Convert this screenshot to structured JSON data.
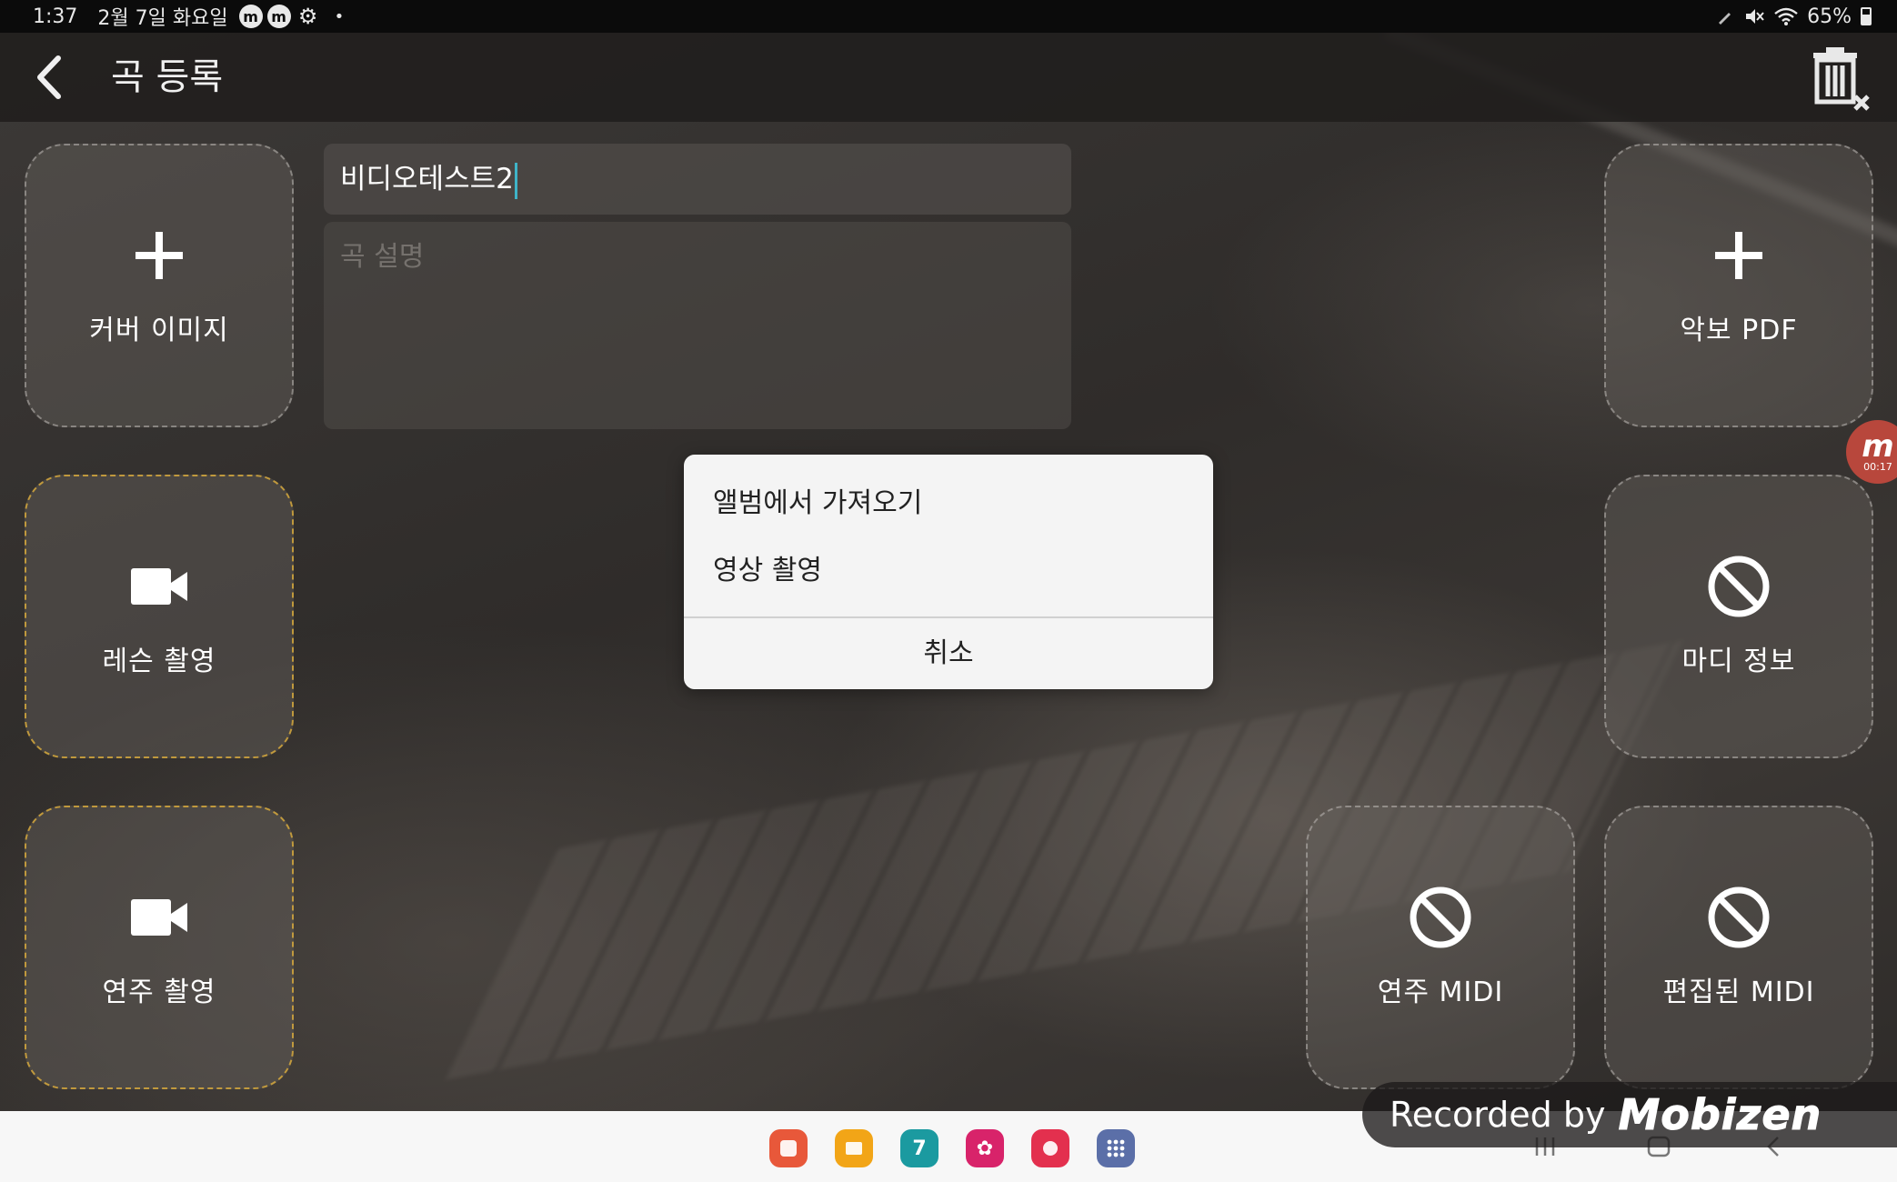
{
  "status_bar": {
    "time": "1:37",
    "date": "2월 7일 화요일",
    "battery": "65%",
    "notification_icons": [
      "mobizen-icon",
      "mobizen-icon",
      "gear-icon",
      "dot-icon"
    ],
    "system_icons": [
      "pen-icon",
      "mute-icon",
      "wifi-icon",
      "battery-icon"
    ]
  },
  "header": {
    "title": "곡 등록",
    "back_icon": "chevron-left-icon",
    "delete_icon": "trash-x-icon"
  },
  "form": {
    "title_value": "비디오테스트2",
    "description_placeholder": "곡 설명"
  },
  "tiles": {
    "cover_image": {
      "label": "커버 이미지",
      "icon": "plus-icon"
    },
    "sheet_pdf": {
      "label": "악보 PDF",
      "icon": "plus-icon"
    },
    "lesson_recording": {
      "label": "레슨 촬영",
      "icon": "video-camera-icon"
    },
    "madi_info": {
      "label": "마디 정보",
      "icon": "block-icon"
    },
    "performance_recording": {
      "label": "연주 촬영",
      "icon": "video-camera-icon"
    },
    "performance_midi": {
      "label": "연주 MIDI",
      "icon": "block-icon"
    },
    "edited_midi": {
      "label": "편집된 MIDI",
      "icon": "block-icon"
    }
  },
  "dialog": {
    "option_album": "앨범에서 가져오기",
    "option_record": "영상 촬영",
    "cancel": "취소"
  },
  "mobizen": {
    "logo_letter": "m",
    "rec_time": "00:17"
  },
  "dock": {
    "apps": [
      {
        "name": "note-app-icon",
        "color": "#e8583a"
      },
      {
        "name": "folder-app-icon",
        "color": "#f2a517"
      },
      {
        "name": "calendar-app-icon",
        "color": "#1b9aa0",
        "label": "7"
      },
      {
        "name": "flower-app-icon",
        "color": "#d8236a"
      },
      {
        "name": "camera-app-icon",
        "color": "#e3304e"
      },
      {
        "name": "apps-grid-icon",
        "color": "#5b6fa8"
      }
    ]
  },
  "watermark": {
    "text": "Recorded by",
    "brand": "Mobizen"
  }
}
